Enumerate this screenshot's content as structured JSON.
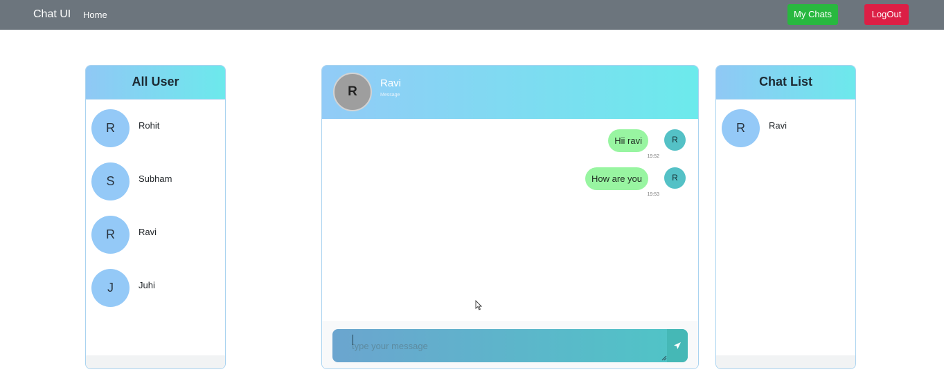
{
  "navbar": {
    "brand": "Chat UI",
    "home": "Home",
    "my_chats": "My Chats",
    "logout": "LogOut",
    "colors": {
      "background": "#6c757d",
      "my_chats": "#28b83f",
      "logout": "#dc1f45"
    }
  },
  "all_users": {
    "title": "All User",
    "users": [
      {
        "initial": "R",
        "name": "Rohit"
      },
      {
        "initial": "S",
        "name": "Subham"
      },
      {
        "initial": "R",
        "name": "Ravi"
      },
      {
        "initial": "J",
        "name": "Juhi"
      }
    ]
  },
  "chat": {
    "contact_initial": "R",
    "contact_name": "Ravi",
    "contact_sub": "Message",
    "messages": [
      {
        "text": "Hii ravi",
        "time": "19:52",
        "sender_initial": "R"
      },
      {
        "text": "How are you",
        "time": "19:53",
        "sender_initial": "R"
      }
    ],
    "input_placeholder": "type your message",
    "send_icon": "send-icon",
    "colors": {
      "bubble": "#98f5a1",
      "header_start": "#92cbf7",
      "header_end": "#6ceaec"
    }
  },
  "chat_list": {
    "title": "Chat List",
    "chats": [
      {
        "initial": "R",
        "name": "Ravi"
      }
    ]
  }
}
